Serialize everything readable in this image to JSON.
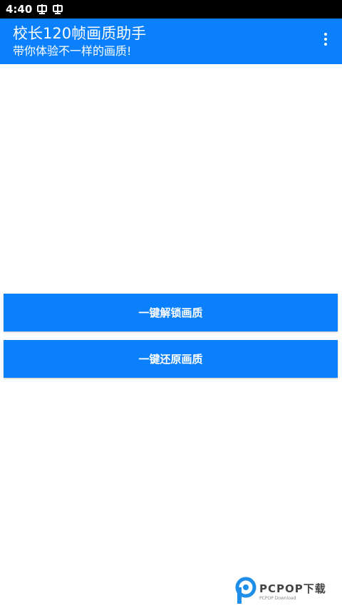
{
  "statusbar": {
    "time": "4:40",
    "icons": [
      "notification-icon",
      "notification-icon"
    ]
  },
  "appbar": {
    "title": "校长120帧画质助手",
    "subtitle": "带你体验不一样的画质!",
    "menu_icon": "more-vert-icon"
  },
  "actions": {
    "unlock_label": "一键解锁画质",
    "restore_label": "一键还原画质"
  },
  "watermark": {
    "main": "PCPOP下载",
    "sub": "PCPOP Download"
  },
  "colors": {
    "primary": "#0a80fc",
    "statusbar": "#000000",
    "background": "#ffffff"
  }
}
